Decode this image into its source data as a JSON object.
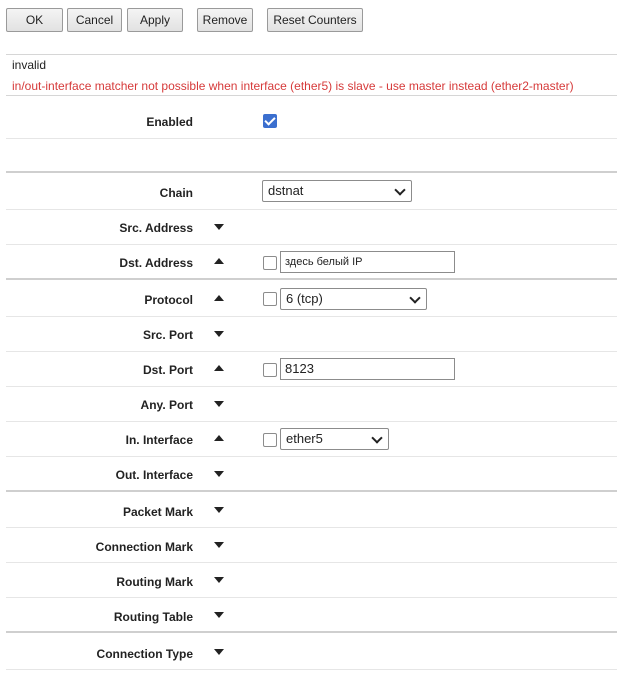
{
  "toolbar": {
    "ok": "OK",
    "cancel": "Cancel",
    "apply": "Apply",
    "remove": "Remove",
    "reset_counters": "Reset Counters"
  },
  "status": {
    "state": "invalid",
    "error": "in/out-interface matcher not possible when interface (ether5) is slave - use master instead (ether2-master)",
    "error_color": "#d63a3a"
  },
  "form": {
    "enabled": {
      "label": "Enabled",
      "checked": true
    },
    "chain": {
      "label": "Chain",
      "value": "dstnat"
    },
    "src_address": {
      "label": "Src. Address"
    },
    "dst_address": {
      "label": "Dst. Address",
      "value": "здесь белый IP",
      "negate": false
    },
    "protocol": {
      "label": "Protocol",
      "value": "6 (tcp)",
      "negate": false
    },
    "src_port": {
      "label": "Src. Port"
    },
    "dst_port": {
      "label": "Dst. Port",
      "value": "8123",
      "negate": false
    },
    "any_port": {
      "label": "Any. Port"
    },
    "in_interface": {
      "label": "In. Interface",
      "value": "ether5",
      "negate": false
    },
    "out_interface": {
      "label": "Out. Interface"
    },
    "packet_mark": {
      "label": "Packet Mark"
    },
    "connection_mark": {
      "label": "Connection Mark"
    },
    "routing_mark": {
      "label": "Routing Mark"
    },
    "routing_table": {
      "label": "Routing Table"
    },
    "connection_type": {
      "label": "Connection Type"
    }
  },
  "colors": {
    "accent": "#3b6fcf"
  }
}
